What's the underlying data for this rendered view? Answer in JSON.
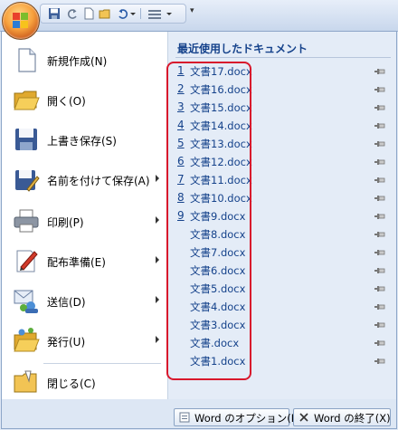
{
  "menu": {
    "items": [
      {
        "label": "新規作成(N)",
        "icon": "new-document-icon",
        "has_submenu": false
      },
      {
        "label": "開く(O)",
        "icon": "open-folder-icon",
        "has_submenu": false
      },
      {
        "label": "上書き保存(S)",
        "icon": "save-disk-icon",
        "has_submenu": false
      },
      {
        "label": "名前を付けて保存(A)",
        "icon": "save-as-icon",
        "has_submenu": true
      },
      {
        "label": "印刷(P)",
        "icon": "printer-icon",
        "has_submenu": true
      },
      {
        "label": "配布準備(E)",
        "icon": "prepare-icon",
        "has_submenu": true
      },
      {
        "label": "送信(D)",
        "icon": "send-icon",
        "has_submenu": true
      },
      {
        "label": "発行(U)",
        "icon": "publish-icon",
        "has_submenu": true
      },
      {
        "label": "閉じる(C)",
        "icon": "close-folder-icon",
        "has_submenu": false
      }
    ]
  },
  "recent": {
    "title": "最近使用したドキュメント",
    "files": [
      {
        "num": "1",
        "name": "文書17.docx"
      },
      {
        "num": "2",
        "name": "文書16.docx"
      },
      {
        "num": "3",
        "name": "文書15.docx"
      },
      {
        "num": "4",
        "name": "文書14.docx"
      },
      {
        "num": "5",
        "name": "文書13.docx"
      },
      {
        "num": "6",
        "name": "文書12.docx"
      },
      {
        "num": "7",
        "name": "文書11.docx"
      },
      {
        "num": "8",
        "name": "文書10.docx"
      },
      {
        "num": "9",
        "name": "文書9.docx"
      },
      {
        "num": "",
        "name": "文書8.docx"
      },
      {
        "num": "",
        "name": "文書7.docx"
      },
      {
        "num": "",
        "name": "文書6.docx"
      },
      {
        "num": "",
        "name": "文書5.docx"
      },
      {
        "num": "",
        "name": "文書4.docx"
      },
      {
        "num": "",
        "name": "文書3.docx"
      },
      {
        "num": "",
        "name": "文書.docx"
      },
      {
        "num": "",
        "name": "文書1.docx"
      }
    ]
  },
  "buttons": {
    "options": "Word のオプション(I)",
    "exit": "Word の終了(X)"
  },
  "colors": {
    "accent": "#15428b",
    "highlight_border": "#d8182c",
    "office_button": "#f7a13d"
  }
}
